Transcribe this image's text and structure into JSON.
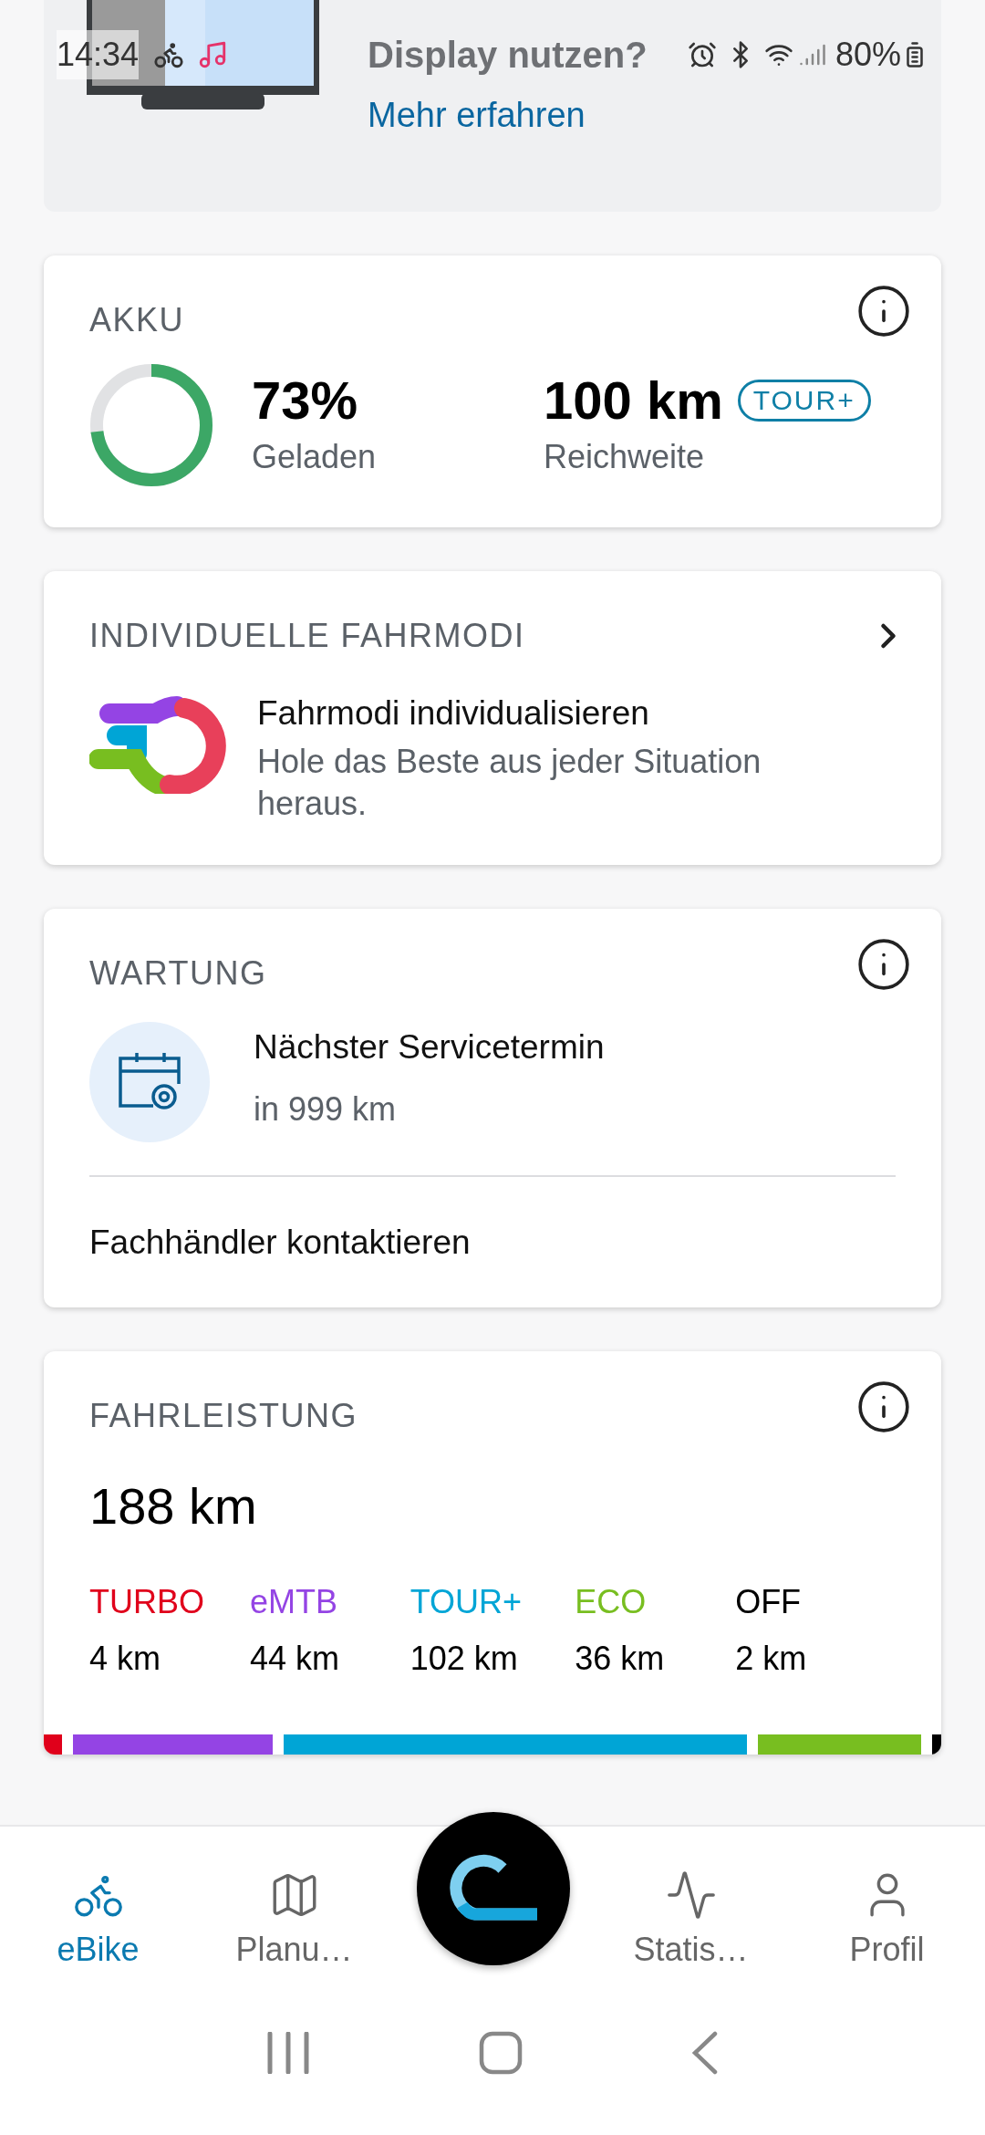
{
  "status_bar": {
    "time": "14:34",
    "battery": "80%"
  },
  "promo": {
    "title_lines": [
      "Display nutzen?"
    ],
    "link": "Mehr erfahren"
  },
  "akku": {
    "title": "AKKU",
    "charge": "73%",
    "level": 0.73,
    "charge_label": "Geladen",
    "range": "100 km",
    "range_label": "Reichweite",
    "mode_badge": "TOUR+"
  },
  "fahrmodi": {
    "title": "INDIVIDUELLE FAHRMODI",
    "heading": "Fahrmodi individualisieren",
    "text": "Hole das Beste aus jeder Situation heraus."
  },
  "wartung": {
    "title": "WARTUNG",
    "heading": "Nächster Servicetermin",
    "text": "in 999 km",
    "link": "Fachhändler kontaktieren"
  },
  "fahrleistung": {
    "title": "FAHRLEISTUNG",
    "total": "188 km",
    "modes": [
      {
        "name": "TURBO",
        "distance": "4 km",
        "color": "#e0001b"
      },
      {
        "name": "eMTB",
        "distance": "44 km",
        "color": "#9444e4"
      },
      {
        "name": "TOUR+",
        "distance": "102 km",
        "color": "#00a5d6"
      },
      {
        "name": "ECO",
        "distance": "36 km",
        "color": "#78be20"
      },
      {
        "name": "OFF",
        "distance": "2 km",
        "color": "#000000"
      }
    ]
  },
  "nav": {
    "items": [
      {
        "label": "eBike",
        "selected": true
      },
      {
        "label": "Planu…",
        "selected": false
      },
      {
        "label": "Statis…",
        "selected": false
      },
      {
        "label": "Profil",
        "selected": false
      }
    ]
  }
}
